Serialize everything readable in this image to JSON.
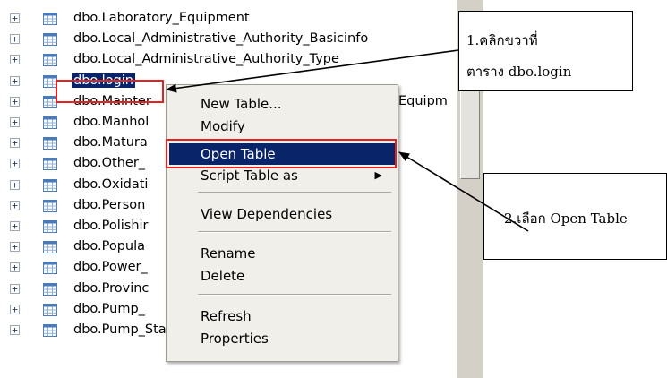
{
  "tree": {
    "items": [
      {
        "label": "dbo.Laboratory_Equipment"
      },
      {
        "label": "dbo.Local_Administrative_Authority_Basicinfo"
      },
      {
        "label": "dbo.Local_Administrative_Authority_Type"
      },
      {
        "label": "dbo.login",
        "selected": true
      },
      {
        "label": "dbo.Mainter"
      },
      {
        "label": "dbo.Manhol"
      },
      {
        "label": "dbo.Matura"
      },
      {
        "label": "dbo.Other_"
      },
      {
        "label": "dbo.Oxidati"
      },
      {
        "label": "dbo.Person"
      },
      {
        "label": "dbo.Polishir"
      },
      {
        "label": "dbo.Popula"
      },
      {
        "label": "dbo.Power_"
      },
      {
        "label": "dbo.Provinc"
      },
      {
        "label": "dbo.Pump_"
      },
      {
        "label": "dbo.Pump_Station_Maintenance_M"
      }
    ],
    "hidden_fragment": "Equipm",
    "expander_glyph": "+",
    "icon": "table-icon"
  },
  "context_menu": {
    "items": [
      {
        "label": "New Table..."
      },
      {
        "label": "Modify"
      },
      {
        "label": "Open Table",
        "highlighted": true
      },
      {
        "label": "Script Table as",
        "submenu": true
      },
      {
        "label": "View Dependencies"
      },
      {
        "label": "Rename"
      },
      {
        "label": "Delete"
      },
      {
        "label": "Refresh"
      },
      {
        "label": "Properties"
      }
    ],
    "submenu_arrow": "▶"
  },
  "callouts": {
    "step1": {
      "line1": "1.คลิกขวาที่",
      "line2": "ตาราง dbo.login"
    },
    "step2": {
      "text": "2.เลือก Open Table"
    }
  },
  "colors": {
    "selection": "#0a246a",
    "annotation_red": "#e82020",
    "menu_bg": "#f1efe9"
  }
}
